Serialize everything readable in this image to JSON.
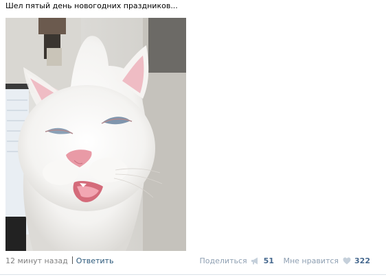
{
  "post": {
    "text": "Шел пятый день новогодних праздников...",
    "image": {
      "subject": "white-cat-photo"
    }
  },
  "footer": {
    "time": "12 минут назад",
    "reply_label": "Ответить",
    "share_label": "Поделиться",
    "share_count": "51",
    "like_label": "Мне нравится",
    "like_count": "322"
  },
  "colors": {
    "link": "#2b587a",
    "muted_link": "#8e9fb2",
    "count": "#45688e",
    "time": "#808080",
    "icon": "#c5d0db"
  }
}
